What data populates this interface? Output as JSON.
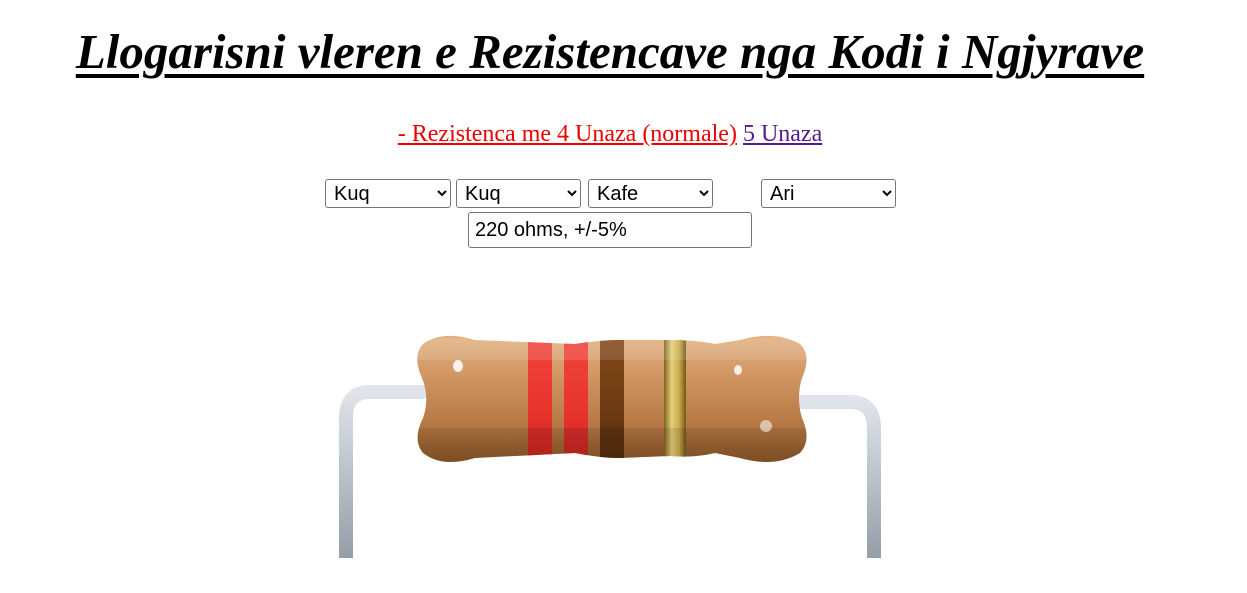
{
  "page": {
    "title": "Llogarisni vleren e Rezistencave nga Kodi i Ngjyrave"
  },
  "nav": {
    "four_band_label": "- Rezistenca me 4 Unaza (normale)",
    "five_band_label": "5 Unaza"
  },
  "bands": {
    "band1": {
      "selected": "Kuq"
    },
    "band2": {
      "selected": "Kuq"
    },
    "multiplier": {
      "selected": "Kafe"
    },
    "tolerance": {
      "selected": "Ari"
    }
  },
  "result": {
    "value": "220 ohms, +/-5%"
  },
  "colors": {
    "title_text": "#000000",
    "link_active": "#ee0000",
    "link_visited": "#551a8b",
    "band_red": "#e8332c",
    "band_brown": "#6b3a12",
    "band_gold": "#c9a94a",
    "resistor_body": "#c98b55",
    "lead_wire": "#b8c0c8"
  }
}
